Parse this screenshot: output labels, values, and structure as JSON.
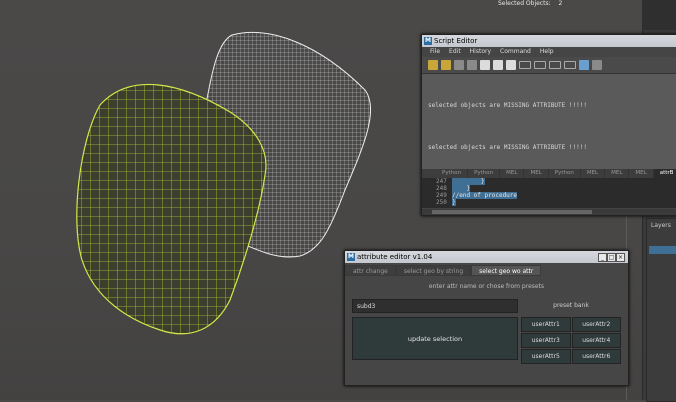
{
  "hud": {
    "label": "Selected Objects:",
    "value": "2"
  },
  "layers": {
    "label": "Layers"
  },
  "script_editor": {
    "title": "Script Editor",
    "menu": [
      "File",
      "Edit",
      "History",
      "Command",
      "Help"
    ],
    "output_lines": [
      "selected objects are MISSING ATTRIBUTE !!!!!",
      "selected objects are MISSING ATTRIBUTE !!!!!"
    ],
    "tabs": [
      "Python",
      "Python",
      "MEL",
      "MEL",
      "Python",
      "MEL",
      "MEL",
      "MEL",
      "attrB"
    ],
    "active_tab_index": 8,
    "code_lines": [
      {
        "num": "247",
        "text": "        }"
      },
      {
        "num": "248",
        "text": "    }"
      },
      {
        "num": "249",
        "text": "//end of procedure"
      },
      {
        "num": "250",
        "text": "}"
      }
    ]
  },
  "attr_editor": {
    "title": "attribute editor v1.04",
    "tabs": [
      "attr change",
      "select geo by string",
      "select geo wo attr"
    ],
    "active_tab_index": 2,
    "hint": "enter attr name or chose from presets",
    "field_value": "subd3",
    "preset_label": "preset bank",
    "update_label": "update selection",
    "presets": [
      "userAttr1",
      "userAttr2",
      "userAttr3",
      "userAttr4",
      "userAttr5",
      "userAttr6"
    ]
  }
}
